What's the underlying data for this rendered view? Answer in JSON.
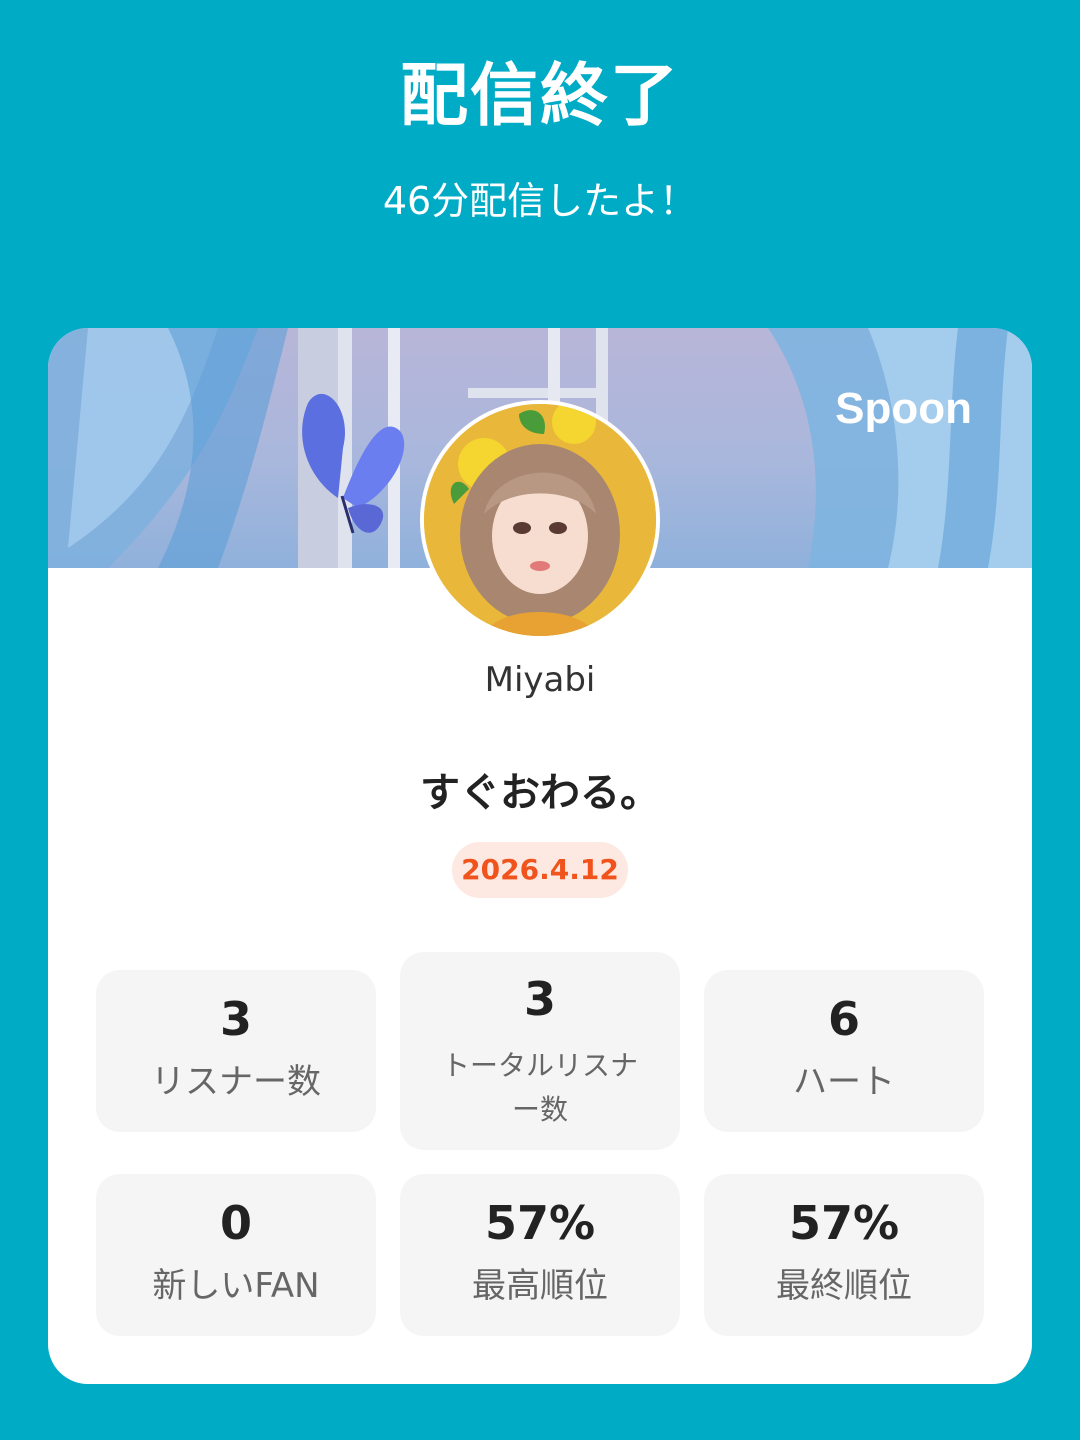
{
  "header": {
    "title": "配信終了",
    "subtitle": "46分配信したよ！"
  },
  "card": {
    "brand": "Spoon",
    "username": "Miyabi",
    "stream_title": "すぐおわる。",
    "date": "2026.4.12",
    "stats": [
      {
        "value": "3",
        "label": "リスナー数"
      },
      {
        "value": "3",
        "label": "トータルリスナー数",
        "label_line1": "トータルリスナ",
        "label_line2": "ー数"
      },
      {
        "value": "6",
        "label": "ハート"
      },
      {
        "value": "0",
        "label": "新しいFAN"
      },
      {
        "value": "57%",
        "label": "最高順位"
      },
      {
        "value": "57%",
        "label": "最終順位"
      }
    ]
  },
  "colors": {
    "background": "#00abc6",
    "date_badge_text": "#f0531c",
    "date_badge_bg": "#fde9e2"
  }
}
